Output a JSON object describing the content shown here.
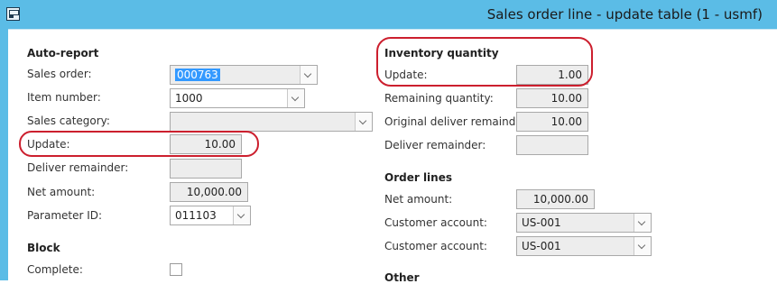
{
  "window": {
    "title": "Sales order line - update table (1 - usmf)"
  },
  "auto_report": {
    "header": "Auto-report",
    "sales_order": {
      "label": "Sales order:",
      "value": "000763"
    },
    "item_number": {
      "label": "Item number:",
      "value": "1000"
    },
    "sales_category": {
      "label": "Sales category:",
      "value": ""
    },
    "update": {
      "label": "Update:",
      "value": "10.00"
    },
    "deliver_remainder": {
      "label": "Deliver remainder:",
      "value": ""
    },
    "net_amount": {
      "label": "Net amount:",
      "value": "10,000.00"
    },
    "parameter_id": {
      "label": "Parameter ID:",
      "value": "011103"
    }
  },
  "block": {
    "header": "Block",
    "complete": {
      "label": "Complete:",
      "checked": false
    }
  },
  "inventory_quantity": {
    "header": "Inventory quantity",
    "update": {
      "label": "Update:",
      "value": "1.00"
    },
    "remaining_quantity": {
      "label": "Remaining quantity:",
      "value": "10.00"
    },
    "original_deliver_remainder": {
      "label": "Original deliver remainder:",
      "value": "10.00"
    },
    "deliver_remainder": {
      "label": "Deliver remainder:",
      "value": ""
    }
  },
  "order_lines": {
    "header": "Order lines",
    "net_amount": {
      "label": "Net amount:",
      "value": "10,000.00"
    },
    "customer_account_1": {
      "label": "Customer account:",
      "value": "US-001"
    },
    "customer_account_2": {
      "label": "Customer account:",
      "value": "US-001"
    }
  },
  "other": {
    "header": "Other"
  },
  "colors": {
    "titlebar": "#5bbce6",
    "highlight": "#cc1f2e",
    "selection": "#3399ff"
  }
}
